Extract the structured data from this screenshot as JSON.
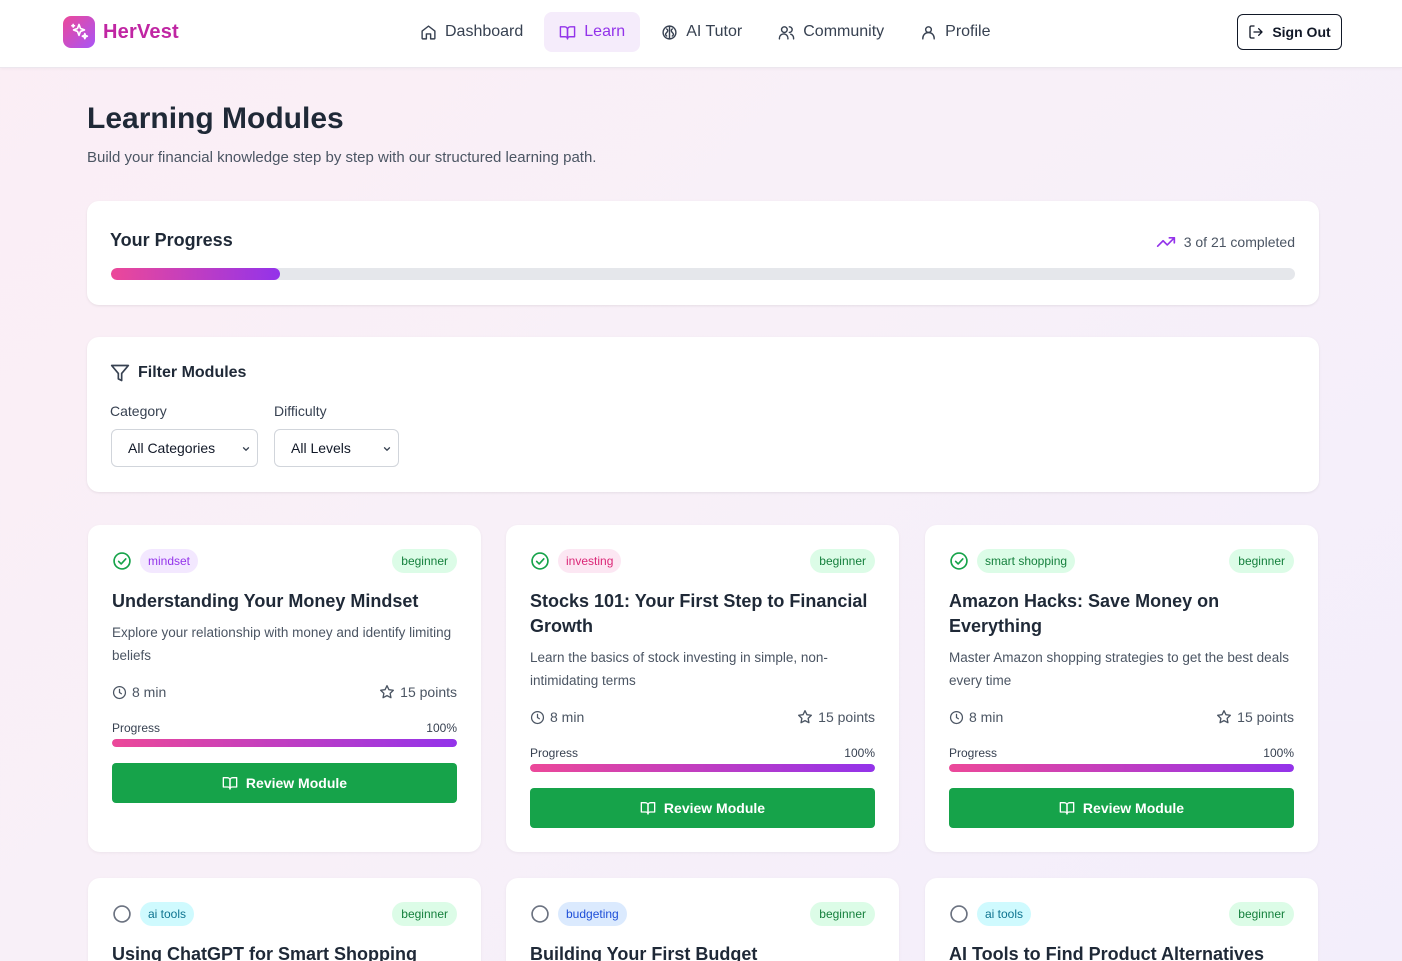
{
  "brand": {
    "name": "HerVest"
  },
  "nav": [
    {
      "label": "Dashboard",
      "icon": "home-icon"
    },
    {
      "label": "Learn",
      "icon": "book-open-icon",
      "active": true
    },
    {
      "label": "AI Tutor",
      "icon": "brain-icon"
    },
    {
      "label": "Community",
      "icon": "users-icon"
    },
    {
      "label": "Profile",
      "icon": "user-icon"
    }
  ],
  "signout": {
    "label": "Sign Out",
    "icon": "log-out-icon"
  },
  "page": {
    "title": "Learning Modules",
    "subtitle": "Build your financial knowledge step by step with our structured learning path."
  },
  "progress": {
    "title": "Your Progress",
    "completed_text": "3 of 21 completed",
    "fraction": 0.1429
  },
  "filters": {
    "title": "Filter Modules",
    "category_label": "Category",
    "category_value": "All Categories",
    "difficulty_label": "Difficulty",
    "difficulty_value": "All Levels"
  },
  "modules": [
    {
      "category": "mindset",
      "difficulty": "beginner",
      "completed": true,
      "title": "Understanding Your Money Mindset",
      "description": "Explore your relationship with money and identify limiting beliefs",
      "duration": "8 min",
      "points": "15 points",
      "progress_label": "Progress",
      "progress_text": "100%",
      "progress": 1.0,
      "cta": "Review Module"
    },
    {
      "category": "investing",
      "difficulty": "beginner",
      "completed": true,
      "title": "Stocks 101: Your First Step to Financial Growth",
      "description": "Learn the basics of stock investing in simple, non-intimidating terms",
      "duration": "8 min",
      "points": "15 points",
      "progress_label": "Progress",
      "progress_text": "100%",
      "progress": 1.0,
      "cta": "Review Module"
    },
    {
      "category": "smart shopping",
      "difficulty": "beginner",
      "completed": true,
      "title": "Amazon Hacks: Save Money on Everything",
      "description": "Master Amazon shopping strategies to get the best deals every time",
      "duration": "8 min",
      "points": "15 points",
      "progress_label": "Progress",
      "progress_text": "100%",
      "progress": 1.0,
      "cta": "Review Module"
    },
    {
      "category": "ai tools",
      "difficulty": "beginner",
      "completed": false,
      "title": "Using ChatGPT for Smart Shopping"
    },
    {
      "category": "budgeting",
      "difficulty": "beginner",
      "completed": false,
      "title": "Building Your First Budget"
    },
    {
      "category": "ai tools",
      "difficulty": "beginner",
      "completed": false,
      "title": "AI Tools to Find Product Alternatives"
    }
  ],
  "colors": {
    "accent": "#9333ea",
    "brand_pink": "#ec4899",
    "cta_green": "#16a34a",
    "check_green": "#16a34a",
    "tag_mindset_bg": "#f3e8ff",
    "tag_mindset_fg": "#9333ea",
    "tag_investing_bg": "#fce7f3",
    "tag_investing_fg": "#db2777",
    "tag_smart_shopping_bg": "#dcfce7",
    "tag_smart_shopping_fg": "#15803d",
    "tag_ai_tools_bg": "#cffafe",
    "tag_ai_tools_fg": "#0e7490",
    "tag_budgeting_bg": "#dbeafe",
    "tag_budgeting_fg": "#1d4ed8"
  }
}
